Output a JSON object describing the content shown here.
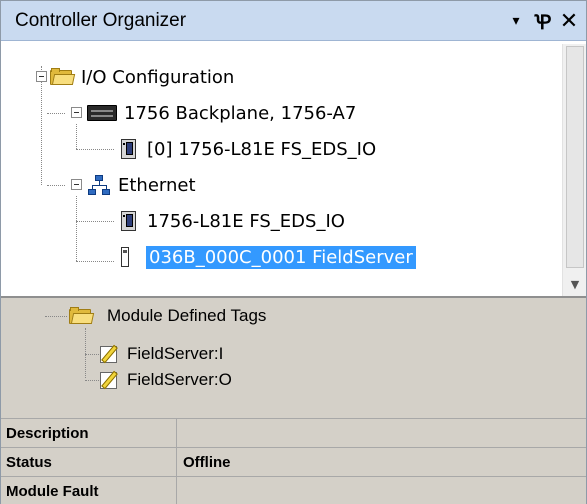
{
  "window": {
    "title": "Controller Organizer"
  },
  "titlebar": {
    "dropdown_glyph": "▾",
    "pin_glyph": "Ꝕ",
    "close_glyph": "✕"
  },
  "tree": {
    "root": {
      "label": "I/O Configuration",
      "icon": "folder-icon"
    },
    "backplane": {
      "label": "1756 Backplane, 1756-A7",
      "icon": "backplane-icon"
    },
    "backplane_module": {
      "label": "[0] 1756-L81E FS_EDS_IO",
      "icon": "module-icon"
    },
    "ethernet": {
      "label": "Ethernet",
      "icon": "network-icon"
    },
    "ethernet_module": {
      "label": "1756-L81E FS_EDS_IO",
      "icon": "module-icon"
    },
    "fieldserver": {
      "label": "036B_000C_0001 FieldServer",
      "icon": "device-icon",
      "selected": true
    }
  },
  "tags": {
    "header": {
      "label": "Module Defined Tags",
      "icon": "folder-icon"
    },
    "input": {
      "label": "FieldServer:I",
      "icon": "tag-icon"
    },
    "output": {
      "label": "FieldServer:O",
      "icon": "tag-icon"
    }
  },
  "properties": [
    {
      "key": "Description",
      "value": ""
    },
    {
      "key": "Status",
      "value": "Offline"
    },
    {
      "key": "Module Fault",
      "value": ""
    }
  ],
  "colors": {
    "selection": "#3399ff",
    "titlebar": "#c9daf0",
    "panel": "#d4d0c8"
  }
}
